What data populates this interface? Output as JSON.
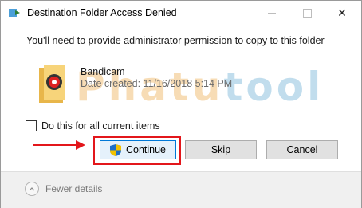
{
  "window": {
    "title": "Destination Folder Access Denied"
  },
  "titlebar": {
    "minimize_icon": "minimize-icon",
    "maximize_icon": "maximize-icon",
    "close_glyph": "✕"
  },
  "dialog": {
    "message": "You'll need to provide administrator permission to copy to this folder",
    "file": {
      "name": "Bandicam",
      "date": "Date created: 11/16/2018 5:14 PM",
      "icon": "folder-icon"
    }
  },
  "watermark": {
    "part1": "Phatu",
    "part2": "tool"
  },
  "checkbox": {
    "label": "Do this for all current items",
    "checked": false
  },
  "buttons": {
    "continue": "Continue",
    "skip": "Skip",
    "cancel": "Cancel"
  },
  "footer": {
    "details": "Fewer details"
  },
  "colors": {
    "highlight": "#e3161b",
    "accent": "#0078d7"
  }
}
